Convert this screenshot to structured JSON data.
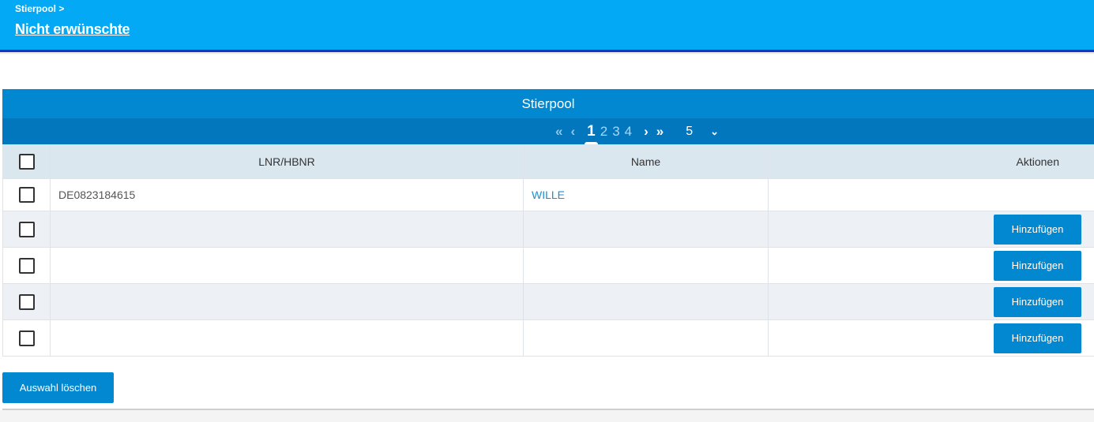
{
  "header": {
    "breadcrumb": "Stierpool >",
    "title": "Nicht erwünschte",
    "bg_color": "#03a9f4",
    "line_color": "#0d2fc7"
  },
  "panel": {
    "title": "Stierpool",
    "pager": {
      "first_icon": "double-chevron-left-icon",
      "prev_icon": "chevron-left-icon",
      "pages": [
        "1",
        "2",
        "3",
        "4"
      ],
      "active_page": "1",
      "next_icon": "chevron-right-icon",
      "last_icon": "double-chevron-right-icon",
      "page_size": "5",
      "page_size_icon": "chevron-down-icon"
    }
  },
  "table": {
    "columns": [
      "LNR/HBNR",
      "Name",
      "Aktionen"
    ],
    "rows": [
      {
        "lnr": "DE0823184615",
        "name": "WILLE",
        "action": ""
      },
      {
        "lnr": "",
        "name": "",
        "action": "Hinzufügen"
      },
      {
        "lnr": "",
        "name": "",
        "action": "Hinzufügen"
      },
      {
        "lnr": "",
        "name": "",
        "action": "Hinzufügen"
      },
      {
        "lnr": "",
        "name": "",
        "action": "Hinzufügen"
      }
    ]
  },
  "footer": {
    "clear_selection": "Auswahl löschen"
  },
  "colors": {
    "accent": "#0288d1",
    "pager_bg": "#0277bd",
    "link": "#1a8fd1"
  }
}
